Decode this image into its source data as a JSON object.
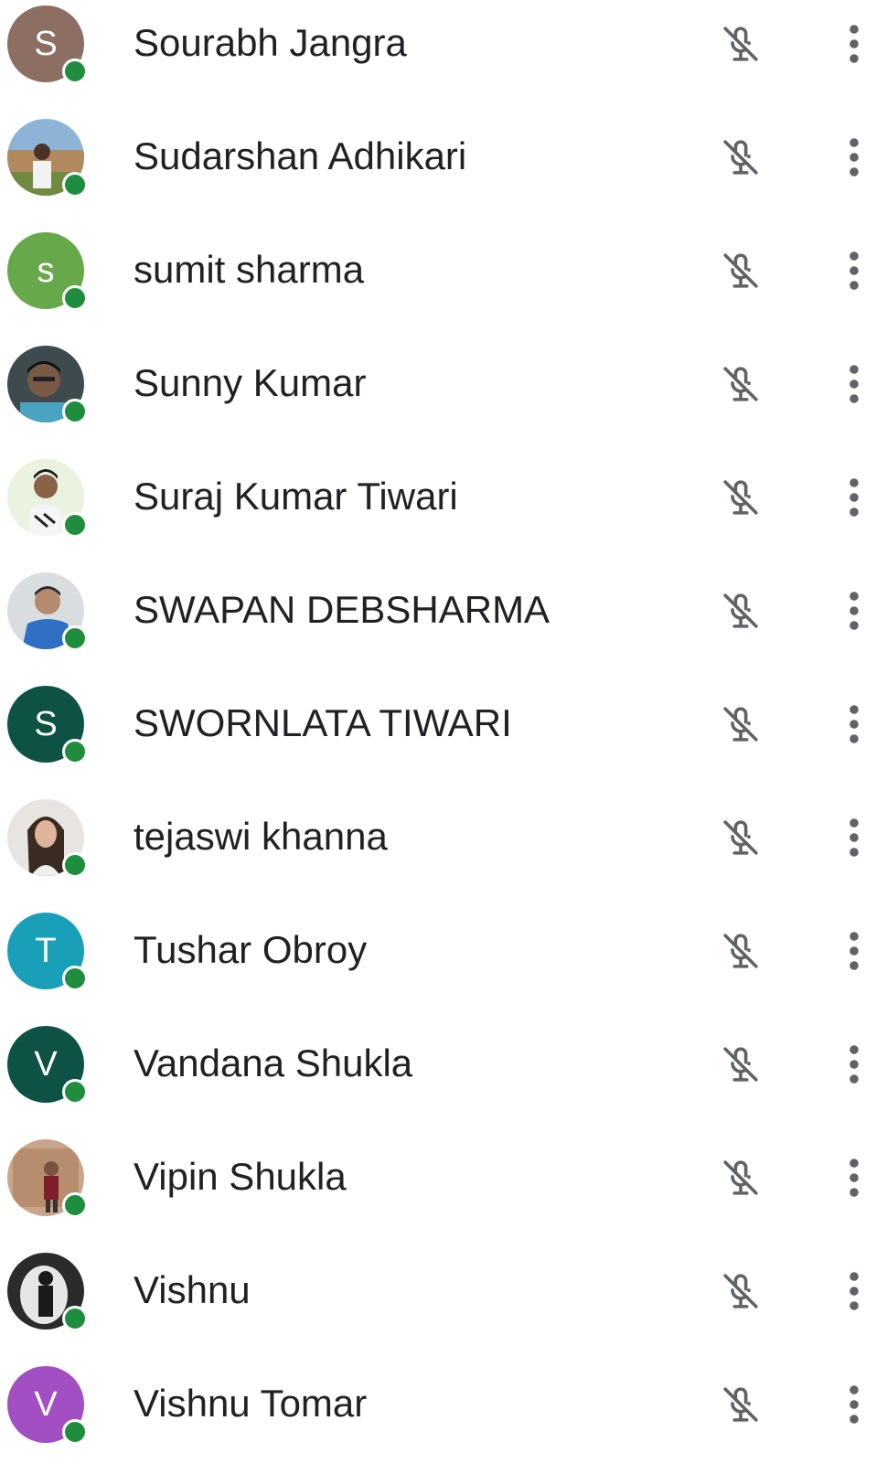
{
  "participants": [
    {
      "name": "Sourabh Jangra",
      "avatar": {
        "type": "initial",
        "initial": "S",
        "color": "#8d6e63"
      },
      "mic_icon": "mic-off-icon",
      "menu_icon": "more-vert-icon"
    },
    {
      "name": "Sudarshan Adhikari",
      "avatar": {
        "type": "photo"
      },
      "mic_icon": "mic-off-icon",
      "menu_icon": "more-vert-icon"
    },
    {
      "name": "sumit sharma",
      "avatar": {
        "type": "initial",
        "initial": "s",
        "color": "#66a84a"
      },
      "mic_icon": "mic-off-icon",
      "menu_icon": "more-vert-icon"
    },
    {
      "name": "Sunny Kumar",
      "avatar": {
        "type": "photo"
      },
      "mic_icon": "mic-off-icon",
      "menu_icon": "more-vert-icon"
    },
    {
      "name": "Suraj Kumar Tiwari",
      "avatar": {
        "type": "photo"
      },
      "mic_icon": "mic-off-icon",
      "menu_icon": "more-vert-icon"
    },
    {
      "name": "SWAPAN DEBSHARMA",
      "avatar": {
        "type": "photo"
      },
      "mic_icon": "mic-off-icon",
      "menu_icon": "more-vert-icon"
    },
    {
      "name": "SWORNLATA TIWARI",
      "avatar": {
        "type": "initial",
        "initial": "S",
        "color": "#0d5245"
      },
      "mic_icon": "mic-off-icon",
      "menu_icon": "more-vert-icon"
    },
    {
      "name": "tejaswi khanna",
      "avatar": {
        "type": "photo"
      },
      "mic_icon": "mic-off-icon",
      "menu_icon": "more-vert-icon"
    },
    {
      "name": "Tushar Obroy",
      "avatar": {
        "type": "initial",
        "initial": "T",
        "color": "#1a9fb8"
      },
      "mic_icon": "mic-off-icon",
      "menu_icon": "more-vert-icon"
    },
    {
      "name": "Vandana Shukla",
      "avatar": {
        "type": "initial",
        "initial": "V",
        "color": "#0d5245"
      },
      "mic_icon": "mic-off-icon",
      "menu_icon": "more-vert-icon"
    },
    {
      "name": "Vipin Shukla",
      "avatar": {
        "type": "photo"
      },
      "mic_icon": "mic-off-icon",
      "menu_icon": "more-vert-icon"
    },
    {
      "name": "Vishnu",
      "avatar": {
        "type": "photo"
      },
      "mic_icon": "mic-off-icon",
      "menu_icon": "more-vert-icon"
    },
    {
      "name": "Vishnu Tomar",
      "avatar": {
        "type": "initial",
        "initial": "V",
        "color": "#a24fc4"
      },
      "mic_icon": "mic-off-icon",
      "menu_icon": "more-vert-icon"
    }
  ],
  "colors": {
    "text": "#202124",
    "icon": "#5f6368",
    "online_status": "#1e8e3e"
  }
}
